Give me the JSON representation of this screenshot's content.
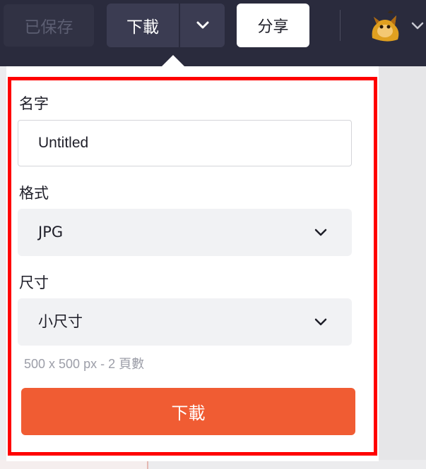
{
  "topbar": {
    "saved_label": "已保存",
    "download_label": "下載",
    "share_label": "分享"
  },
  "panel": {
    "name_label": "名字",
    "name_value": "Untitled",
    "format_label": "格式",
    "format_value": "JPG",
    "size_label": "尺寸",
    "size_value": "小尺寸",
    "meta_text": "500 x 500 px - 2 頁數",
    "submit_label": "下載"
  },
  "icons": {
    "dropdown": "chevron-down-icon",
    "avatar": "user-avatar"
  },
  "colors": {
    "topbar_bg": "#2a2b3d",
    "accent": "#f05c33",
    "highlight": "#ff0000"
  }
}
